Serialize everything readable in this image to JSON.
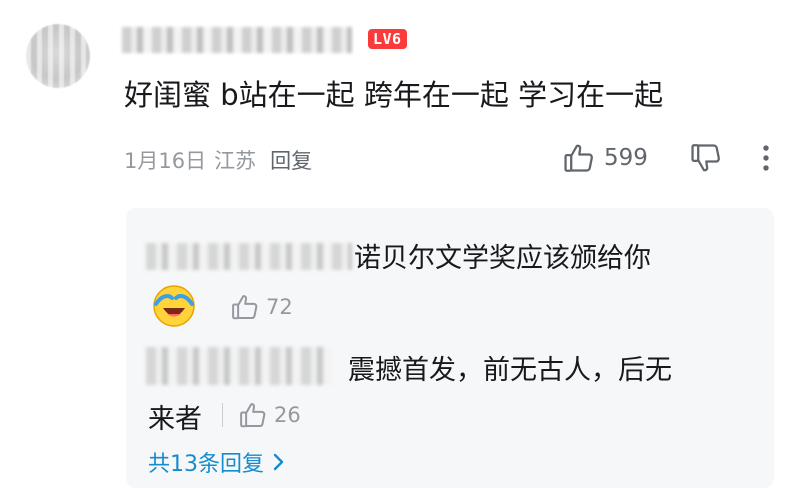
{
  "comment": {
    "level_badge": "LV6",
    "text": "好闺蜜 b站在一起 跨年在一起 学习在一起",
    "date": "1月16日",
    "location": "江苏",
    "reply_label": "回复",
    "like_count": "599",
    "icons": [
      "thumbs-up-icon",
      "thumbs-down-icon",
      "more-vertical-icon"
    ]
  },
  "replies": [
    {
      "text": "诺贝尔文学奖应该颁给你",
      "emoji": "laughing-crying-emoji",
      "like_count": "72"
    },
    {
      "text_line1": "震撼首发，前无古人，后无",
      "text_line2": "来者",
      "like_count": "26"
    }
  ],
  "total_replies_label": "共13条回复",
  "colors": {
    "level_badge": "#fb3b3b",
    "link_blue": "#178bcf",
    "meta_gray": "#9499a0",
    "reply_bg": "#f6f7f8"
  }
}
